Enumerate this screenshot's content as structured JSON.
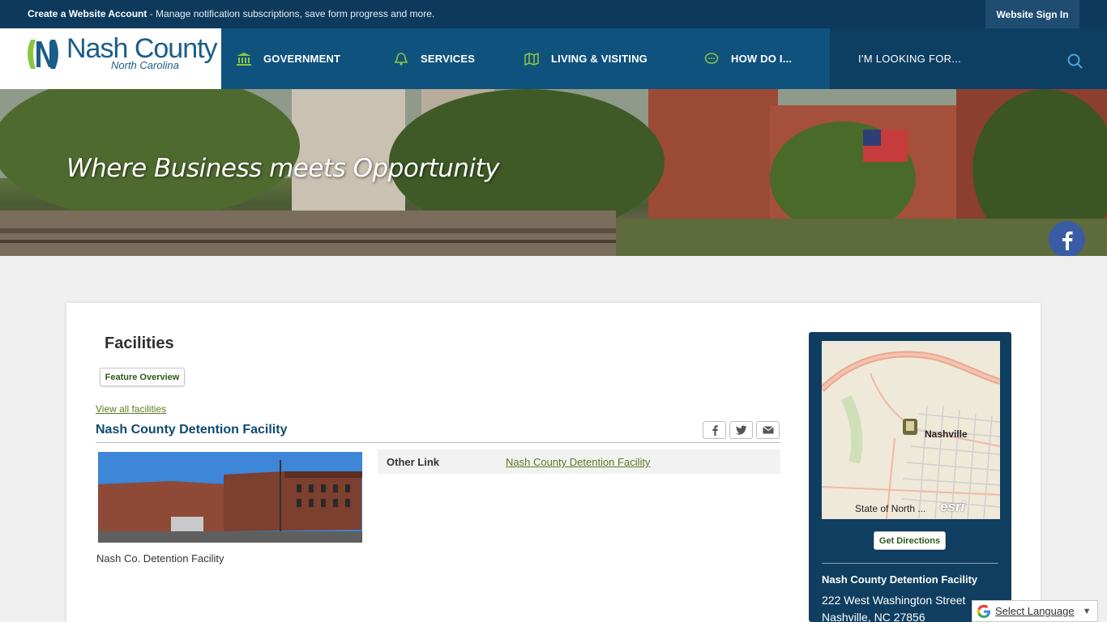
{
  "topbar": {
    "account_link": "Create a Website Account",
    "message": " - Manage notification subscriptions, save form progress and more.",
    "sign_in": "Website Sign In"
  },
  "logo": {
    "title": "Nash County",
    "subtitle": "North Carolina"
  },
  "nav": [
    {
      "label": "GOVERNMENT",
      "icon": "government-building-icon"
    },
    {
      "label": "SERVICES",
      "icon": "bell-icon"
    },
    {
      "label": "LIVING & VISITING",
      "icon": "map-icon"
    },
    {
      "label": "HOW DO I...",
      "icon": "speech-bubble-icon"
    }
  ],
  "search": {
    "placeholder": "I'M LOOKING FOR..."
  },
  "banner": {
    "tagline": "Where Business meets Opportunity"
  },
  "social": [
    "facebook-icon",
    "twitter-icon",
    "youtube-icon"
  ],
  "page": {
    "title": "Facilities",
    "feature_overview": "Feature Overview",
    "view_all": "View all facilities",
    "facility_name": "Nash County Detention Facility",
    "photo_caption": "Nash Co. Detention Facility",
    "other_link_label": "Other Link",
    "other_link_value": "Nash County Detention Facility"
  },
  "sidebar": {
    "map_town": "Nashville",
    "map_caption": "State of North ...",
    "map_label_esri": "esri",
    "get_directions": "Get Directions",
    "name": "Nash County Detention Facility",
    "address1": "222 West Washington Street",
    "address2": "Nashville, NC 27856"
  },
  "language": {
    "label": "Select Language",
    "arrow": "▼"
  },
  "colors": {
    "header": "#0f527d",
    "topbar": "#0d3a5c",
    "link": "#5c7a1e",
    "accent_green": "#7ab52f"
  }
}
